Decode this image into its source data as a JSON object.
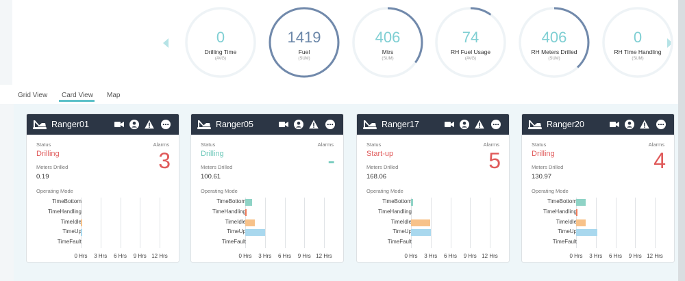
{
  "kpis": [
    {
      "value": "0",
      "label": "Drilling Time",
      "sub": "(AVG)",
      "fraction": 0.0
    },
    {
      "value": "1419",
      "label": "Fuel",
      "sub": "(SUM)",
      "fraction": 1.0
    },
    {
      "value": "406",
      "label": "Mtrs",
      "sub": "(SUM)",
      "fraction": 0.35
    },
    {
      "value": "74",
      "label": "RH Fuel Usage",
      "sub": "(AVG)",
      "fraction": 0.1
    },
    {
      "value": "406",
      "label": "RH Meters Drilled",
      "sub": "(SUM)",
      "fraction": 0.38
    },
    {
      "value": "0",
      "label": "RH Time Handling",
      "sub": "(SUM)",
      "fraction": 0.0
    }
  ],
  "tabs": [
    {
      "label": "Grid View",
      "active": false
    },
    {
      "label": "Card View",
      "active": true
    },
    {
      "label": "Map",
      "active": false
    }
  ],
  "labels": {
    "status": "Status",
    "alarms": "Alarms",
    "meters": "Meters Drilled",
    "opmode": "Operating Mode"
  },
  "modes": [
    "TimeBottom",
    "TimeHandling",
    "TimeIdle",
    "TimeUp",
    "TimeFault"
  ],
  "ticks": [
    "0 Hrs",
    "3 Hrs",
    "6 Hrs",
    "9 Hrs",
    "12 Hrs"
  ],
  "colors": {
    "drilling": "#e05a5a",
    "startup": "#e05a5a",
    "ok": "#6cc8b9",
    "TimeBottom": "#8fd3c6",
    "TimeHandling": "#f07b5a",
    "TimeIdle": "#f7c28a",
    "TimeUp": "#a9d8ee",
    "TimeFault": "#cccccc"
  },
  "cards": [
    {
      "name": "Ranger01",
      "status": "Drilling",
      "status_color": "#e05a5a",
      "alarms": "3",
      "meters": "0.19",
      "hours": {
        "TimeBottom": 0,
        "TimeHandling": 0,
        "TimeIdle": 0.1,
        "TimeUp": 0.05,
        "TimeFault": 0
      }
    },
    {
      "name": "Ranger05",
      "status": "Drilling",
      "status_color": "#6cc8b9",
      "alarms": "-",
      "meters": "100.61",
      "hours": {
        "TimeBottom": 1.0,
        "TimeHandling": 0.2,
        "TimeIdle": 1.5,
        "TimeUp": 3.0,
        "TimeFault": 0
      }
    },
    {
      "name": "Ranger17",
      "status": "Start-up",
      "status_color": "#e05a5a",
      "alarms": "5",
      "meters": "168.06",
      "hours": {
        "TimeBottom": 0.35,
        "TimeHandling": 0,
        "TimeIdle": 2.9,
        "TimeUp": 3.0,
        "TimeFault": 0
      }
    },
    {
      "name": "Ranger20",
      "status": "Drilling",
      "status_color": "#e05a5a",
      "alarms": "4",
      "meters": "130.97",
      "hours": {
        "TimeBottom": 1.5,
        "TimeHandling": 0.15,
        "TimeIdle": 1.5,
        "TimeUp": 3.2,
        "TimeFault": 0
      }
    }
  ]
}
